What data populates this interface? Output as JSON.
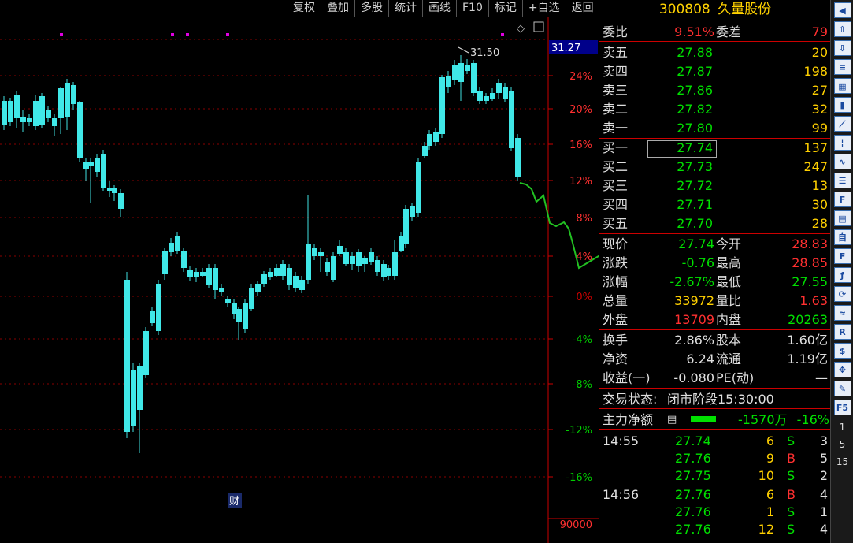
{
  "toolbar": [
    "复权",
    "叠加",
    "多股",
    "统计",
    "画线",
    "F10",
    "标记",
    "+自选",
    "返回"
  ],
  "chart_data": {
    "type": "candlestick",
    "price_axis_ticks": [
      "24%",
      "20%",
      "16%",
      "12%",
      "8%",
      "4%",
      "0%",
      "-4%",
      "-8%",
      "-12%",
      "-16%"
    ],
    "current_price_tag": "31.27",
    "high_marker": "31.50",
    "volume_label": "90000",
    "fin_badge": "财"
  },
  "stock": {
    "code": "300808",
    "name": "久量股份"
  },
  "weibi": {
    "label": "委比",
    "value": "9.51%",
    "label2": "委差",
    "value2": "79"
  },
  "sell": [
    {
      "label": "卖五",
      "price": "27.88",
      "vol": "20"
    },
    {
      "label": "卖四",
      "price": "27.87",
      "vol": "198"
    },
    {
      "label": "卖三",
      "price": "27.86",
      "vol": "27"
    },
    {
      "label": "卖二",
      "price": "27.82",
      "vol": "32"
    },
    {
      "label": "卖一",
      "price": "27.80",
      "vol": "99"
    }
  ],
  "buy": [
    {
      "label": "买一",
      "price": "27.74",
      "vol": "137"
    },
    {
      "label": "买二",
      "price": "27.73",
      "vol": "247"
    },
    {
      "label": "买三",
      "price": "27.72",
      "vol": "13"
    },
    {
      "label": "买四",
      "price": "27.71",
      "vol": "30"
    },
    {
      "label": "买五",
      "price": "27.70",
      "vol": "28"
    }
  ],
  "quote": [
    {
      "l": "现价",
      "v": "27.74",
      "vc": "green",
      "l2": "今开",
      "v2": "28.83",
      "v2c": "red"
    },
    {
      "l": "涨跌",
      "v": "-0.76",
      "vc": "green",
      "l2": "最高",
      "v2": "28.85",
      "v2c": "red"
    },
    {
      "l": "涨幅",
      "v": "-2.67%",
      "vc": "green",
      "l2": "最低",
      "v2": "27.55",
      "v2c": "green"
    },
    {
      "l": "总量",
      "v": "33972",
      "vc": "yellow",
      "l2": "量比",
      "v2": "1.63",
      "v2c": "red"
    },
    {
      "l": "外盘",
      "v": "13709",
      "vc": "red",
      "l2": "内盘",
      "v2": "20263",
      "v2c": "green"
    }
  ],
  "stats": [
    {
      "l": "换手",
      "v": "2.86%",
      "l2": "股本",
      "v2": "1.60亿"
    },
    {
      "l": "净资",
      "v": "6.24",
      "l2": "流通",
      "v2": "1.19亿"
    },
    {
      "l": "收益(一)",
      "v": "-0.080",
      "l2": "PE(动)",
      "v2": "—"
    }
  ],
  "trade_status": {
    "label": "交易状态:",
    "value": "闭市阶段",
    "time": "15:30:00"
  },
  "main_flow": {
    "label": "主力净额",
    "amount": "-1570万",
    "pct": "-16%"
  },
  "ticks": [
    {
      "time": "14:55",
      "price": "27.74",
      "vol": "6",
      "side": "S",
      "n": "3"
    },
    {
      "time": "",
      "price": "27.76",
      "vol": "9",
      "side": "B",
      "n": "5"
    },
    {
      "time": "",
      "price": "27.75",
      "vol": "10",
      "side": "S",
      "n": "2"
    },
    {
      "time": "14:56",
      "price": "27.76",
      "vol": "6",
      "side": "B",
      "n": "4"
    },
    {
      "time": "",
      "price": "27.76",
      "vol": "1",
      "side": "S",
      "n": "1"
    },
    {
      "time": "",
      "price": "27.76",
      "vol": "12",
      "side": "S",
      "n": "4"
    }
  ],
  "sidebar_nums": [
    "1",
    "5",
    "15"
  ]
}
